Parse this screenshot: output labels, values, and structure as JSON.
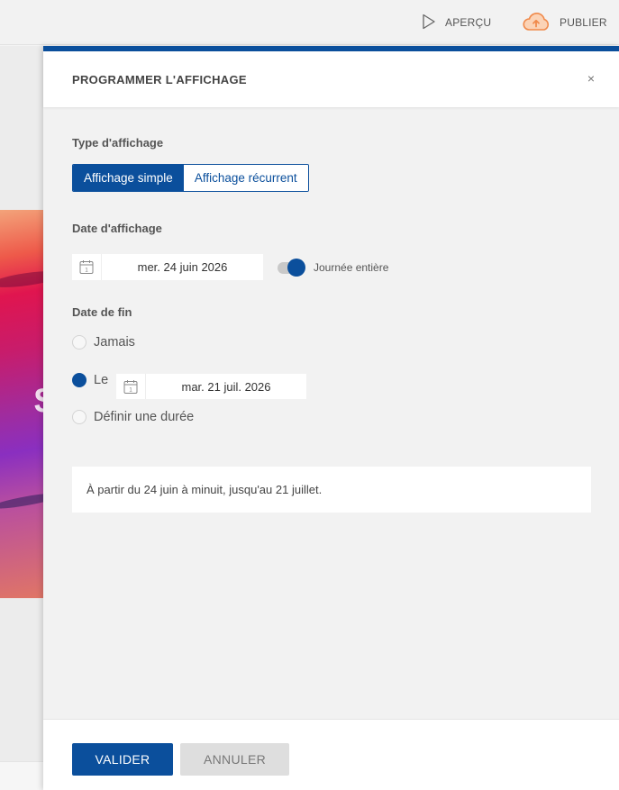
{
  "topbar": {
    "preview_label": "APERÇU",
    "publish_label": "PUBLIER"
  },
  "background": {
    "glyph": "$"
  },
  "drawer": {
    "title": "PROGRAMMER L'AFFICHAGE",
    "close_symbol": "×",
    "display_type": {
      "label": "Type d'affichage",
      "options": [
        "Affichage simple",
        "Affichage récurrent"
      ],
      "selected": "Affichage simple"
    },
    "display_date": {
      "label": "Date d'affichage",
      "value": "mer. 24 juin 2026",
      "calendar_day": "1",
      "all_day_label": "Journée entière",
      "all_day_on": true
    },
    "end_date": {
      "label": "Date de fin",
      "options": [
        {
          "label": "Jamais",
          "checked": false
        },
        {
          "label": "Le",
          "checked": true
        },
        {
          "label": "Définir une durée",
          "checked": false
        }
      ],
      "value": "mar. 21 juil. 2026",
      "calendar_day": "1"
    },
    "summary": "À partir du 24 juin à minuit, jusqu'au 21 juillet.",
    "buttons": {
      "validate": "VALIDER",
      "cancel": "ANNULER"
    }
  },
  "colors": {
    "accent": "#0b4f9c",
    "publish_icon": "#f08a4b"
  },
  "icons": [
    "play-icon",
    "cloud-upload-icon",
    "close-icon",
    "calendar-icon"
  ]
}
